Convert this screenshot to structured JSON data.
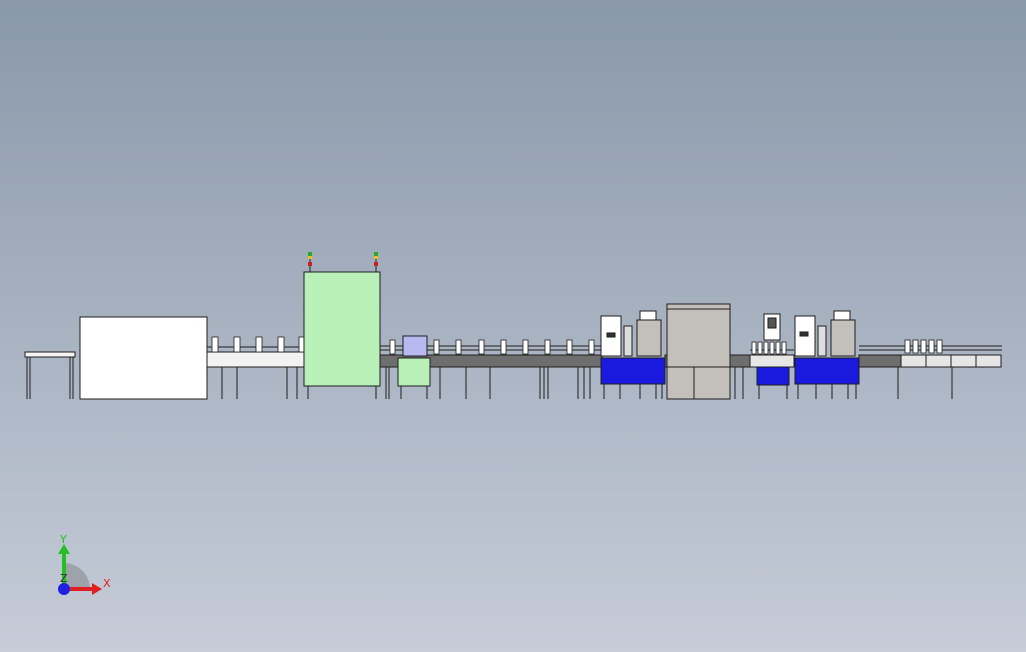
{
  "viewport": {
    "background_top": "#8998aa",
    "background_bottom": "#c6ccd8"
  },
  "colors": {
    "green_machine": "#b8f0b8",
    "blue_frame": "#1a1adf",
    "gray_cabinet": "#c3c0bb",
    "conveyor_dark": "#6e6e6e",
    "lavender_box": "#b9b9f2",
    "outline": "#1e1e1e"
  },
  "triad": {
    "icon": "coordinate-triad-icon",
    "x_label": "X",
    "y_label": "Y",
    "z_label": "Z",
    "x_color": "#e02020",
    "y_color": "#22c022",
    "z_color": "#2020e0"
  }
}
